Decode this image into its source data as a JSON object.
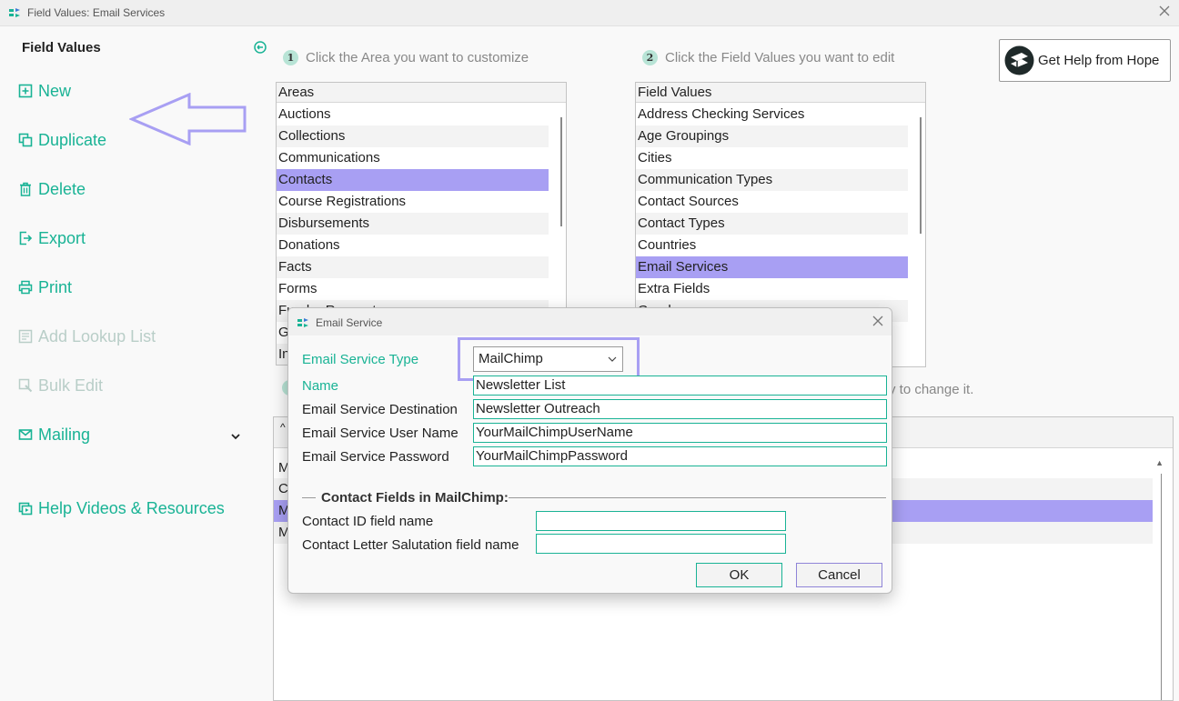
{
  "window": {
    "title": "Field Values: Email Services"
  },
  "sidebar": {
    "title": "Field Values",
    "items": [
      {
        "label": "New",
        "icon": "plus-square-icon",
        "enabled": true
      },
      {
        "label": "Duplicate",
        "icon": "duplicate-icon",
        "enabled": true
      },
      {
        "label": "Delete",
        "icon": "trash-icon",
        "enabled": true
      },
      {
        "label": "Export",
        "icon": "export-icon",
        "enabled": true
      },
      {
        "label": "Print",
        "icon": "printer-icon",
        "enabled": true
      },
      {
        "label": "Add Lookup List",
        "icon": "lookup-list-icon",
        "enabled": false
      },
      {
        "label": "Bulk Edit",
        "icon": "bulk-edit-icon",
        "enabled": false
      },
      {
        "label": "Mailing",
        "icon": "mailing-icon",
        "enabled": true
      },
      {
        "label": "Help Videos & Resources",
        "icon": "video-icon",
        "enabled": true
      }
    ]
  },
  "steps": {
    "step1": {
      "number": "1",
      "text": "Click the Area you want to customize"
    },
    "step2": {
      "number": "2",
      "text": "Click the Field Values you want to edit"
    },
    "step3_hint": "ry to change it."
  },
  "areas": {
    "header": "Areas",
    "items": [
      "Auctions",
      "Collections",
      "Communications",
      "Contacts",
      "Course Registrations",
      "Disbursements",
      "Donations",
      "Facts",
      "Forms",
      "Funder Requests",
      "G",
      "In"
    ],
    "selected": "Contacts"
  },
  "field_values": {
    "header": "Field Values",
    "items": [
      "Address Checking Services",
      "Age Groupings",
      "Cities",
      "Communication Types",
      "Contact Sources",
      "Contact Types",
      "Countries",
      "Email Services",
      "Extra Fields",
      "Genders"
    ],
    "selected": "Email Services"
  },
  "help_button": {
    "label": "Get Help from Hope"
  },
  "grid": {
    "sort_indicator": "^",
    "rows": [
      "M",
      "C",
      "M",
      "M"
    ],
    "selected_index": 2
  },
  "dialog": {
    "title": "Email Service",
    "service_type": {
      "label": "Email Service Type",
      "value": "MailChimp"
    },
    "name": {
      "label": "Name",
      "value": "Newsletter List"
    },
    "destination": {
      "label": "Email Service Destination",
      "value": "Newsletter Outreach"
    },
    "user_name": {
      "label": "Email Service User Name",
      "value": "YourMailChimpUserName"
    },
    "password": {
      "label": "Email Service Password",
      "value": "YourMailChimpPassword"
    },
    "contact_fields_title": "Contact Fields in MailChimp:",
    "contact_id": {
      "label": "Contact ID field name",
      "value": ""
    },
    "salutation": {
      "label": "Contact Letter Salutation field name",
      "value": ""
    },
    "ok_label": "OK",
    "cancel_label": "Cancel"
  },
  "colors": {
    "accent": "#19b395",
    "selection": "#a89ff3",
    "highlight": "#a89ff3",
    "disabled": "#b9cec8"
  }
}
